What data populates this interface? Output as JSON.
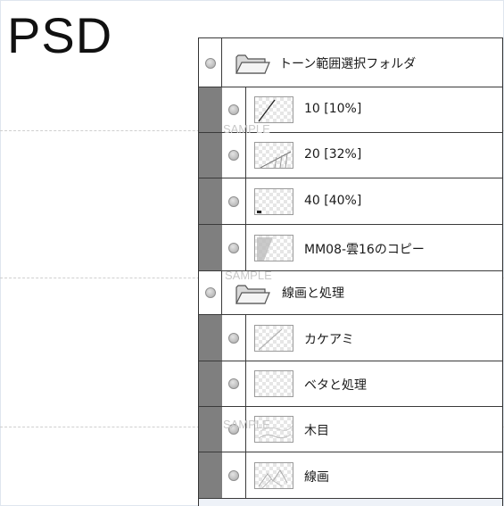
{
  "heading": "PSD",
  "watermark": "SAMPLE",
  "layers": [
    {
      "type": "folder",
      "label": "トーン範囲選択フォルダ",
      "icon": "folder-icon"
    },
    {
      "type": "layer",
      "label": "10 [10%]",
      "thumb": "diagonal-line-thumb"
    },
    {
      "type": "layer",
      "label": "20 [32%]",
      "thumb": "hatch-thumb"
    },
    {
      "type": "layer",
      "label": "40 [40%]",
      "thumb": "corner-mark-thumb"
    },
    {
      "type": "layer",
      "label": "MM08-雲16のコピー",
      "thumb": "cloud-tone-thumb"
    },
    {
      "type": "folder",
      "label": "線画と処理",
      "icon": "folder-icon"
    },
    {
      "type": "layer",
      "label": "カケアミ",
      "thumb": "faint-line-thumb"
    },
    {
      "type": "layer",
      "label": "ベタと処理",
      "thumb": "blank-thumb"
    },
    {
      "type": "layer",
      "label": "木目",
      "thumb": "woodgrain-thumb"
    },
    {
      "type": "layer",
      "label": "線画",
      "thumb": "lineart-thumb"
    }
  ],
  "colors": {
    "indent_bar": "#7f7f7f",
    "row_border": "#3a3a3a",
    "visibility_dot": "#a9a9a9"
  }
}
